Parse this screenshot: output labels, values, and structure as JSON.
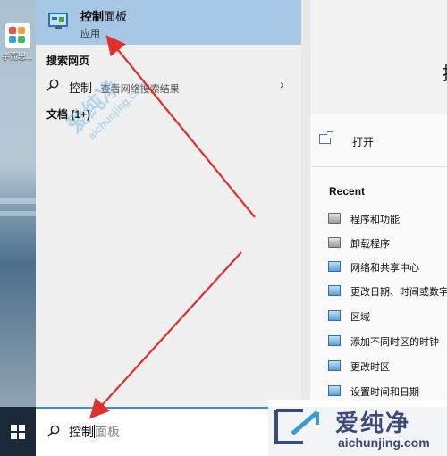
{
  "desktop": {
    "icon_label": "学而思..."
  },
  "best_match": {
    "title_bold": "控制",
    "title_rest": "面板",
    "subtitle": "应用"
  },
  "web_section": {
    "header": "搜索网页",
    "query": "控制",
    "sub": " - 查看网络搜索结果"
  },
  "docs_section": {
    "header": "文档 (1+)"
  },
  "detail": {
    "title_partial": "控",
    "open_label": "打开",
    "recent_header": "Recent",
    "recent": [
      {
        "label": "程序和功能",
        "icon": "programs-icon"
      },
      {
        "label": "卸载程序",
        "icon": "programs-icon"
      },
      {
        "label": "网络和共享中心",
        "icon": "control-panel-icon"
      },
      {
        "label": "更改日期、时间或数字",
        "icon": "control-panel-icon"
      },
      {
        "label": "区域",
        "icon": "control-panel-icon"
      },
      {
        "label": "添加不同时区的时钟",
        "icon": "control-panel-icon"
      },
      {
        "label": "更改时区",
        "icon": "control-panel-icon"
      },
      {
        "label": "设置时间和日期",
        "icon": "control-panel-icon"
      }
    ]
  },
  "search": {
    "typed": "控制",
    "suggestion": "面板"
  },
  "watermark": {
    "cn": "爱纯净",
    "en": "aichunjing.com",
    "diag_cn": "爱纯净",
    "diag_en": "aichunjing.com"
  },
  "colors": {
    "accent": "#3c8fd8",
    "best_match_bg": "#a6c8e6",
    "taskbar": "#1b2a38",
    "arrow": "#e0302a"
  }
}
